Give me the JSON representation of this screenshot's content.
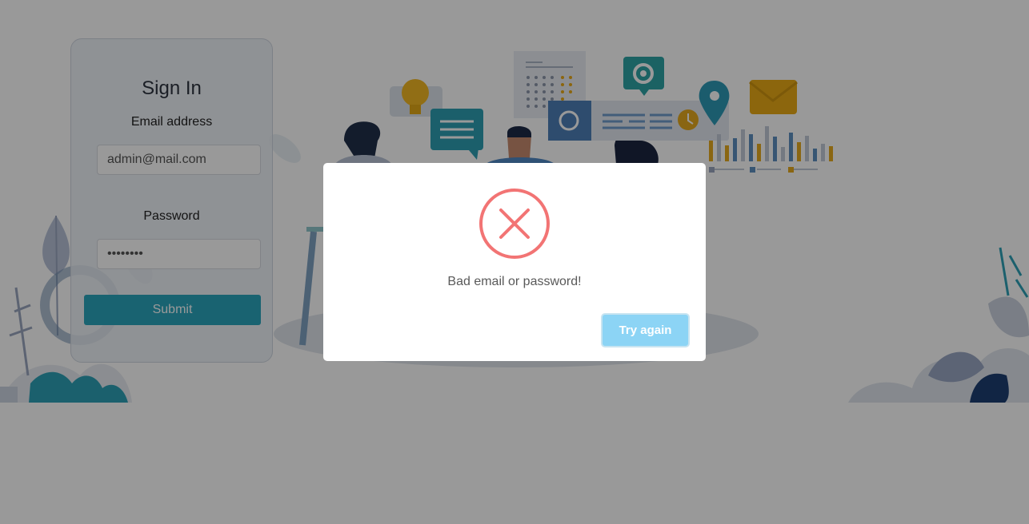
{
  "login": {
    "title": "Sign In",
    "email_label": "Email address",
    "email_value": "admin@mail.com",
    "password_label": "Password",
    "password_value": "••••••••",
    "submit_label": "Submit"
  },
  "dialog": {
    "icon": "error-x-icon",
    "message": "Bad email or password!",
    "confirm_label": "Try again"
  },
  "colors": {
    "accent": "#2ba6bd",
    "error": "#f27474",
    "confirm_button": "#8cd4f5",
    "overlay": "rgba(0,0,0,0.4)"
  }
}
